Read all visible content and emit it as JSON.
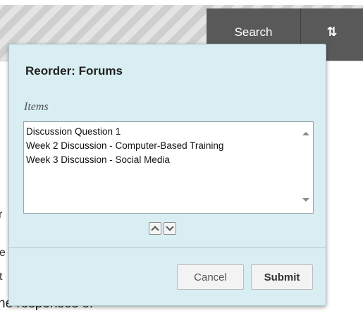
{
  "toolbar": {
    "search_label": "Search",
    "sort_label": "⇅",
    "sort_icon": "sort-arrows-icon"
  },
  "background_text": {
    "fragment_1": "r",
    "fragment_2": "e",
    "fragment_3": "t",
    "fragment_4": "he responses of"
  },
  "dialog": {
    "title": "Reorder: Forums",
    "items_label": "Items",
    "items": [
      "Discussion Question 1",
      "Week 2 Discussion - Computer-Based Training",
      "Week 3 Discussion - Social Media"
    ],
    "move_up_icon": "chevron-up-icon",
    "move_down_icon": "chevron-down-icon",
    "cancel_label": "Cancel",
    "submit_label": "Submit"
  },
  "colors": {
    "dialog_background": "#d8eef2",
    "toolbar_button": "#595959"
  }
}
